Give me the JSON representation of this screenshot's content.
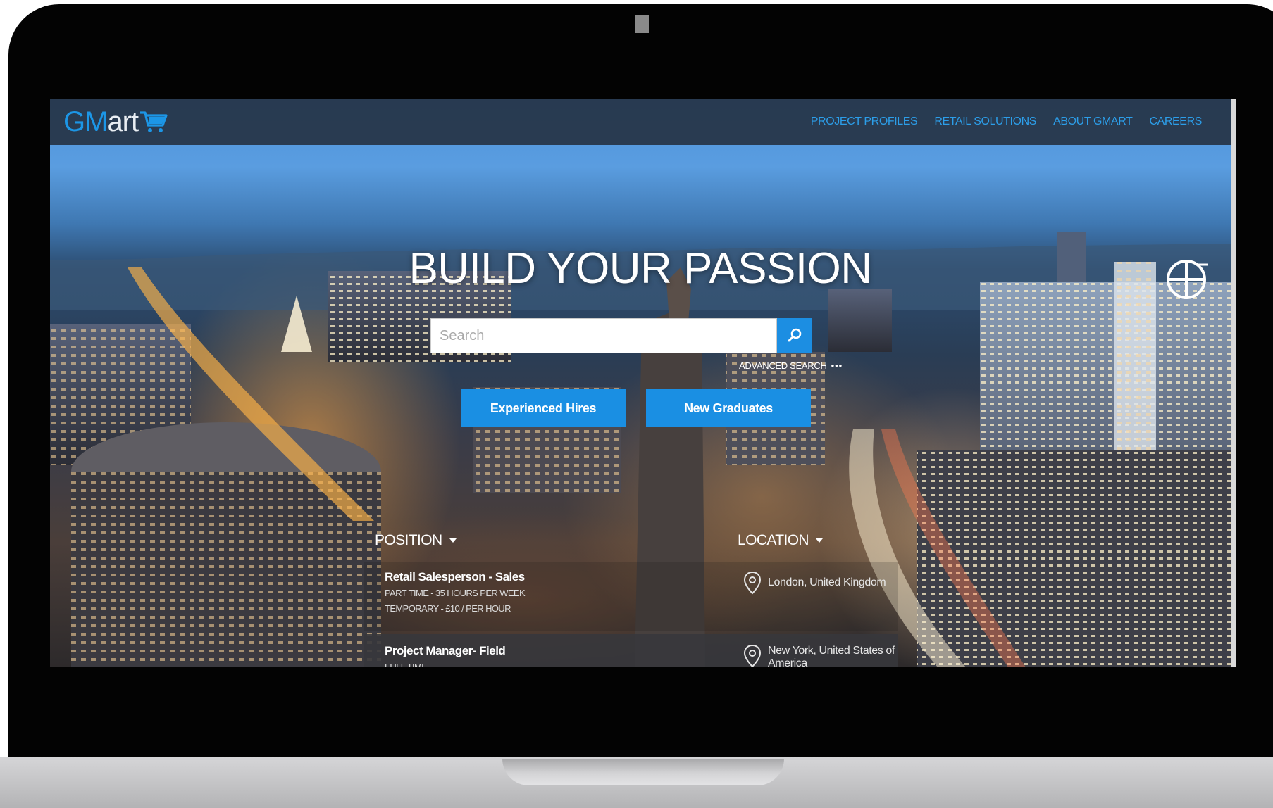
{
  "header": {
    "logo": {
      "part1": "GM",
      "part2": "art",
      "icon": "shopping-cart-icon"
    },
    "nav": [
      {
        "label": "PROJECT PROFILES"
      },
      {
        "label": "RETAIL SOLUTIONS"
      },
      {
        "label": "ABOUT GMART"
      },
      {
        "label": "CAREERS"
      }
    ]
  },
  "hero": {
    "title": "BUILD YOUR PASSION",
    "search": {
      "placeholder": "Search",
      "value": "",
      "icon": "search-icon"
    },
    "advanced_search": "ADVANCED SEARCH",
    "advanced_search_dots": "•••",
    "buttons": {
      "experienced": "Experienced Hires",
      "graduates": "New Graduates"
    }
  },
  "listing": {
    "position_header": "POSITION",
    "location_header": "LOCATION",
    "jobs": [
      {
        "title": "Retail Salesperson - Sales",
        "meta": [
          "PART TIME - 35 HOURS PER WEEK",
          "TEMPORARY - £10 / PER HOUR"
        ],
        "location": "London, United Kingdom"
      },
      {
        "title": "Project Manager- Field",
        "meta": [
          "FULL TIME"
        ],
        "location": "New York, United States of America"
      }
    ]
  },
  "colors": {
    "accent": "#1a8fe3",
    "nav_link": "#2c9ee9",
    "header_bg": "#263446"
  }
}
